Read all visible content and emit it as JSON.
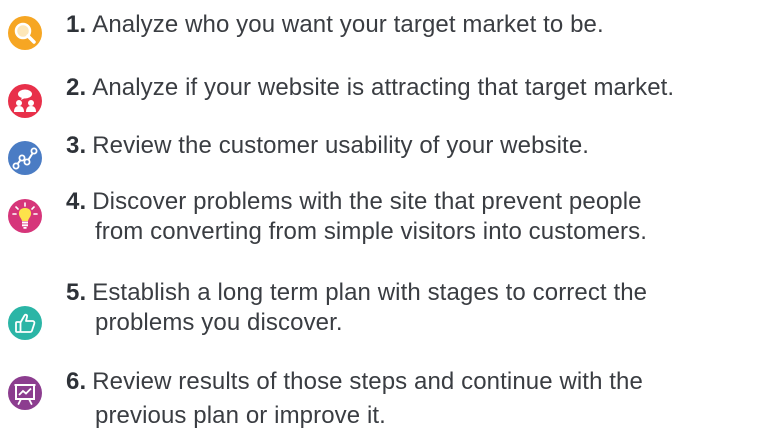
{
  "steps": [
    {
      "number": "1.",
      "line1": "Analyze who you want your target market to be.",
      "line2": "",
      "icon": "magnifier-icon",
      "color": "#f6a623"
    },
    {
      "number": "2.",
      "line1": "Analyze if your website is attracting that target market.",
      "line2": "",
      "icon": "audience-chat-icon",
      "color": "#e8304a"
    },
    {
      "number": "3.",
      "line1": "Review the customer usability of your website.",
      "line2": "",
      "icon": "analytics-graph-icon",
      "color": "#4a7cc4"
    },
    {
      "number": "4.",
      "line1": "Discover problems with the site that prevent people",
      "line2": "from converting from simple visitors into customers.",
      "icon": "lightbulb-icon",
      "color": "#d6357a"
    },
    {
      "number": "5.",
      "line1": "Establish a long term plan with stages to correct the",
      "line2": "problems you discover.",
      "icon": "thumbs-up-icon",
      "color": "#2bb5a6"
    },
    {
      "number": "6.",
      "line1": "Review results of those steps and continue with the",
      "line2": "previous plan or improve it.",
      "icon": "presentation-chart-icon",
      "color": "#8c3d8f"
    }
  ]
}
